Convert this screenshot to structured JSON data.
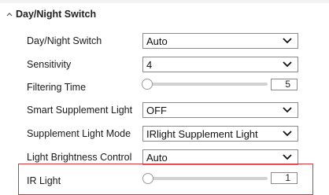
{
  "section": {
    "title": "Day/Night Switch",
    "caret_icon": "caret-up-icon"
  },
  "rows": {
    "day_night_switch": {
      "label": "Day/Night Switch",
      "value": "Auto"
    },
    "sensitivity": {
      "label": "Sensitivity",
      "value": "4"
    },
    "filtering_time": {
      "label": "Filtering Time",
      "value": "5",
      "slider_fraction": 0.0
    },
    "smart_supplement_light": {
      "label": "Smart Supplement Light",
      "value": "OFF"
    },
    "supplement_light_mode": {
      "label": "Supplement Light Mode",
      "value": "IRlight Supplement Light"
    },
    "light_brightness_control": {
      "label": "Light Brightness Control",
      "value": "Auto"
    },
    "ir_light": {
      "label": "IR Light",
      "value": "1",
      "slider_fraction": 0.01
    }
  },
  "colors": {
    "accent": "#e03a2f",
    "highlight_border": "#d9363e"
  }
}
